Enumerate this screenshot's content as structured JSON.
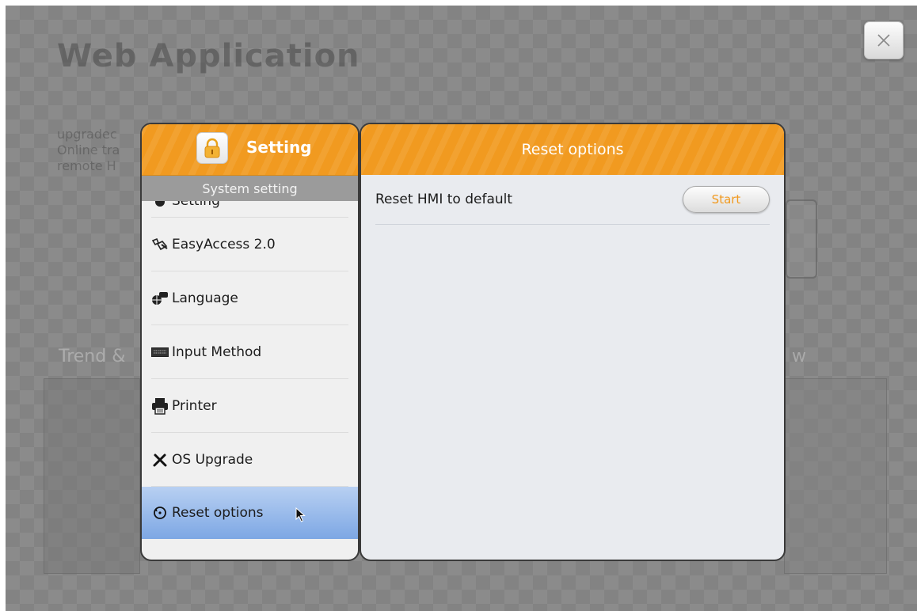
{
  "background": {
    "heading": "Web Application",
    "paragraph_lines": [
      "upgradec",
      "Online tra",
      "remote H"
    ],
    "trend_text": "Trend &",
    "right_fragment": "w"
  },
  "settings_panel": {
    "title": "Setting",
    "group_label": "System setting",
    "items": [
      {
        "label": "Setting",
        "icon": "gear-icon"
      },
      {
        "label": "EasyAccess 2.0",
        "icon": "easyaccess-icon"
      },
      {
        "label": "Language",
        "icon": "globe-chat-icon"
      },
      {
        "label": "Input Method",
        "icon": "keyboard-icon"
      },
      {
        "label": "Printer",
        "icon": "printer-icon"
      },
      {
        "label": "OS Upgrade",
        "icon": "tools-icon"
      },
      {
        "label": "Reset options",
        "icon": "reset-icon"
      }
    ],
    "selected_item": "Reset options"
  },
  "reset_panel": {
    "title": "Reset options",
    "option_label": "Reset HMI to default",
    "start_button": "Start"
  },
  "colors": {
    "header_orange": "#f19a20",
    "selected_blue": "#8fb4ea"
  }
}
